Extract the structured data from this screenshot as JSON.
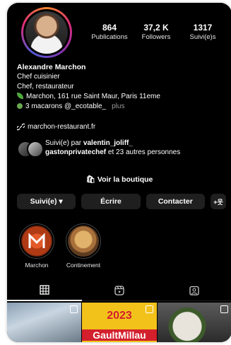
{
  "profile": {
    "stats": [
      {
        "value": "864",
        "label": "Publications"
      },
      {
        "value": "37,2 K",
        "label": "Followers"
      },
      {
        "value": "1317",
        "label": "Suivi(e)s"
      }
    ],
    "name": "Alexandre Marchon",
    "bio_lines": [
      "Chef cuisinier",
      "Chef, restaurateur",
      "Marchon, 161 rue Saint Maur, Paris 11eme",
      "3 macarons @_ecotable_"
    ],
    "more_label": "plus",
    "link": "marchon-restaurant.fr",
    "followed_prefix": "Suivi(e) par",
    "followed_bold_1": "valentin_joliff_",
    "followed_bold_2": "gastonprivatechef",
    "followed_suffix": "et 23 autres personnes"
  },
  "shop_label": "Voir la boutique",
  "buttons": {
    "following": "Suivi(e) ▾",
    "message": "Écrire",
    "contact": "Contacter",
    "add_person": "+웃"
  },
  "highlights": [
    {
      "label": "Marchon"
    },
    {
      "label": "Continement"
    }
  ],
  "grid": {
    "cell2_year": "2023",
    "cell2_brand": "GaultMillau"
  },
  "colors": {
    "background": "#000000",
    "button_bg": "#1f1f1f",
    "leaf": "#4fa83d",
    "gaultmillau_yellow": "#f2c21b",
    "gaultmillau_red": "#d3202c"
  }
}
